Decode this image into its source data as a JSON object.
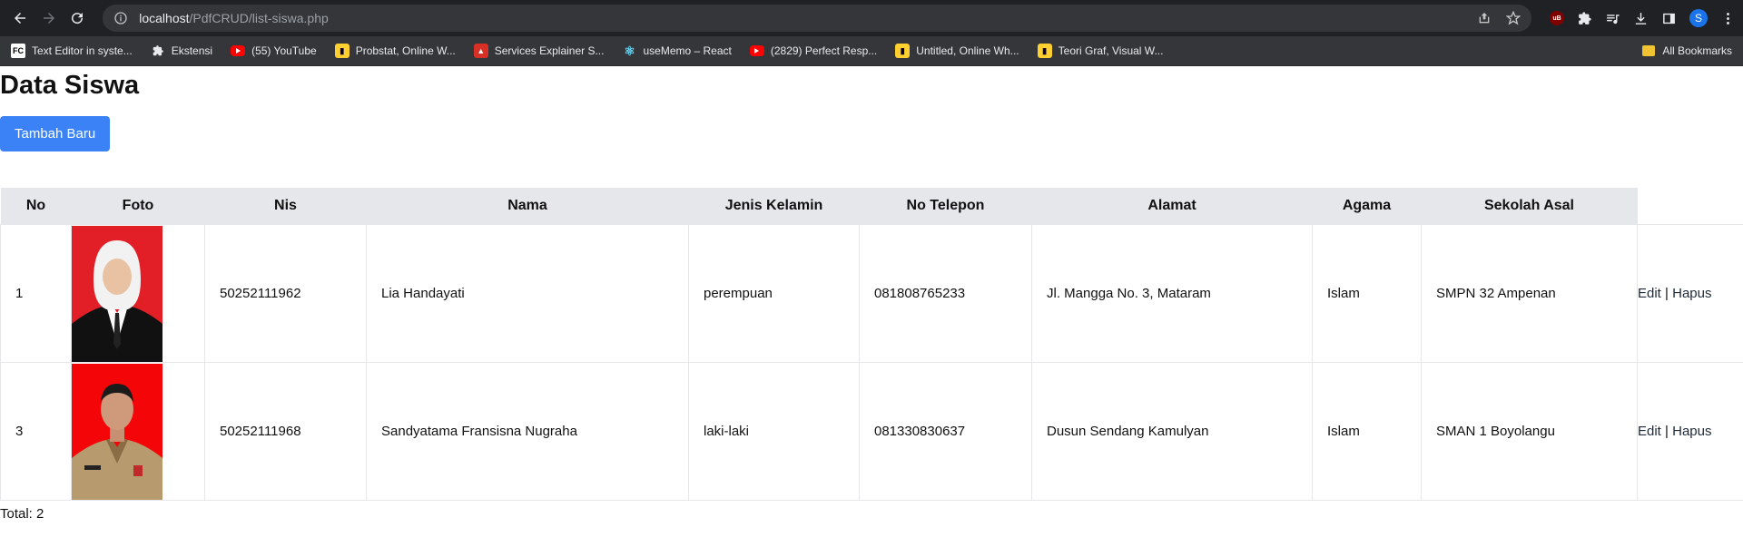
{
  "browser": {
    "url_host": "localhost",
    "url_path": "/PdfCRUD/list-siswa.php",
    "avatar_letter": "S",
    "ext_badge": "uB",
    "bookmarks": [
      {
        "label": "Text Editor in syste...",
        "icon": "fc-icon",
        "icon_text": "FC"
      },
      {
        "label": "Ekstensi",
        "icon": "puzzle-icon"
      },
      {
        "label": "(55) YouTube",
        "icon": "youtube-icon"
      },
      {
        "label": "Probstat, Online W...",
        "icon": "miro-icon"
      },
      {
        "label": "Services Explainer S...",
        "icon": "service-icon"
      },
      {
        "label": "useMemo – React",
        "icon": "react-icon"
      },
      {
        "label": "(2829) Perfect Resp...",
        "icon": "youtube-icon"
      },
      {
        "label": "Untitled, Online Wh...",
        "icon": "miro-icon"
      },
      {
        "label": "Teori Graf, Visual W...",
        "icon": "miro-icon"
      }
    ],
    "all_bookmarks": "All Bookmarks"
  },
  "page": {
    "title": "Data Siswa",
    "add_button": "Tambah Baru",
    "table": {
      "headers": [
        "No",
        "Foto",
        "Nis",
        "Nama",
        "Jenis Kelamin",
        "No Telepon",
        "Alamat",
        "Agama",
        "Sekolah Asal"
      ],
      "rows": [
        {
          "no": "1",
          "nis": "50252111962",
          "nama": "Lia Handayati",
          "jk": "perempuan",
          "telp": "081808765233",
          "alamat": "Jl. Mangga No. 3, Mataram",
          "agama": "Islam",
          "sekolah": "SMPN 32 Ampenan",
          "edit": "Edit",
          "sep": "|",
          "hapus": "Hapus"
        },
        {
          "no": "3",
          "nis": "50252111968",
          "nama": "Sandyatama Fransisna Nugraha",
          "jk": "laki-laki",
          "telp": "081330830637",
          "alamat": "Dusun Sendang Kamulyan",
          "agama": "Islam",
          "sekolah": "SMAN 1 Boyolangu",
          "edit": "Edit",
          "sep": "|",
          "hapus": "Hapus"
        }
      ]
    },
    "total_label": "Total: 2"
  },
  "colors": {
    "accent": "#3b82f6",
    "header_bg": "#e5e7eb",
    "chrome_bg": "#202124"
  }
}
